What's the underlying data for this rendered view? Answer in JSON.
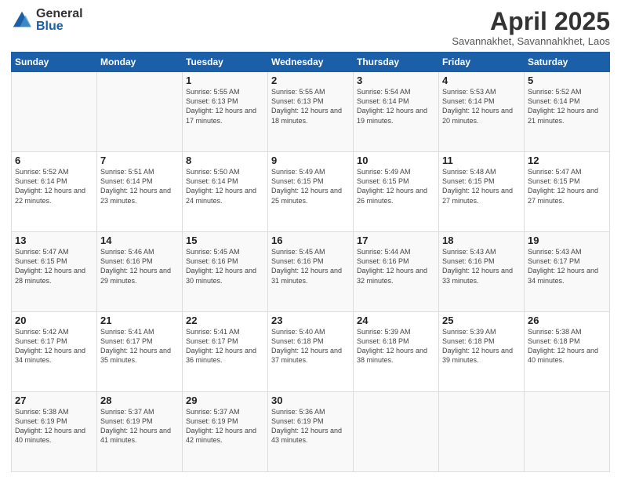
{
  "logo": {
    "general": "General",
    "blue": "Blue"
  },
  "header": {
    "month": "April 2025",
    "location": "Savannakhet, Savannahkhet, Laos"
  },
  "weekdays": [
    "Sunday",
    "Monday",
    "Tuesday",
    "Wednesday",
    "Thursday",
    "Friday",
    "Saturday"
  ],
  "weeks": [
    [
      {
        "day": "",
        "info": ""
      },
      {
        "day": "",
        "info": ""
      },
      {
        "day": "1",
        "info": "Sunrise: 5:55 AM\nSunset: 6:13 PM\nDaylight: 12 hours and 17 minutes."
      },
      {
        "day": "2",
        "info": "Sunrise: 5:55 AM\nSunset: 6:13 PM\nDaylight: 12 hours and 18 minutes."
      },
      {
        "day": "3",
        "info": "Sunrise: 5:54 AM\nSunset: 6:14 PM\nDaylight: 12 hours and 19 minutes."
      },
      {
        "day": "4",
        "info": "Sunrise: 5:53 AM\nSunset: 6:14 PM\nDaylight: 12 hours and 20 minutes."
      },
      {
        "day": "5",
        "info": "Sunrise: 5:52 AM\nSunset: 6:14 PM\nDaylight: 12 hours and 21 minutes."
      }
    ],
    [
      {
        "day": "6",
        "info": "Sunrise: 5:52 AM\nSunset: 6:14 PM\nDaylight: 12 hours and 22 minutes."
      },
      {
        "day": "7",
        "info": "Sunrise: 5:51 AM\nSunset: 6:14 PM\nDaylight: 12 hours and 23 minutes."
      },
      {
        "day": "8",
        "info": "Sunrise: 5:50 AM\nSunset: 6:14 PM\nDaylight: 12 hours and 24 minutes."
      },
      {
        "day": "9",
        "info": "Sunrise: 5:49 AM\nSunset: 6:15 PM\nDaylight: 12 hours and 25 minutes."
      },
      {
        "day": "10",
        "info": "Sunrise: 5:49 AM\nSunset: 6:15 PM\nDaylight: 12 hours and 26 minutes."
      },
      {
        "day": "11",
        "info": "Sunrise: 5:48 AM\nSunset: 6:15 PM\nDaylight: 12 hours and 27 minutes."
      },
      {
        "day": "12",
        "info": "Sunrise: 5:47 AM\nSunset: 6:15 PM\nDaylight: 12 hours and 27 minutes."
      }
    ],
    [
      {
        "day": "13",
        "info": "Sunrise: 5:47 AM\nSunset: 6:15 PM\nDaylight: 12 hours and 28 minutes."
      },
      {
        "day": "14",
        "info": "Sunrise: 5:46 AM\nSunset: 6:16 PM\nDaylight: 12 hours and 29 minutes."
      },
      {
        "day": "15",
        "info": "Sunrise: 5:45 AM\nSunset: 6:16 PM\nDaylight: 12 hours and 30 minutes."
      },
      {
        "day": "16",
        "info": "Sunrise: 5:45 AM\nSunset: 6:16 PM\nDaylight: 12 hours and 31 minutes."
      },
      {
        "day": "17",
        "info": "Sunrise: 5:44 AM\nSunset: 6:16 PM\nDaylight: 12 hours and 32 minutes."
      },
      {
        "day": "18",
        "info": "Sunrise: 5:43 AM\nSunset: 6:16 PM\nDaylight: 12 hours and 33 minutes."
      },
      {
        "day": "19",
        "info": "Sunrise: 5:43 AM\nSunset: 6:17 PM\nDaylight: 12 hours and 34 minutes."
      }
    ],
    [
      {
        "day": "20",
        "info": "Sunrise: 5:42 AM\nSunset: 6:17 PM\nDaylight: 12 hours and 34 minutes."
      },
      {
        "day": "21",
        "info": "Sunrise: 5:41 AM\nSunset: 6:17 PM\nDaylight: 12 hours and 35 minutes."
      },
      {
        "day": "22",
        "info": "Sunrise: 5:41 AM\nSunset: 6:17 PM\nDaylight: 12 hours and 36 minutes."
      },
      {
        "day": "23",
        "info": "Sunrise: 5:40 AM\nSunset: 6:18 PM\nDaylight: 12 hours and 37 minutes."
      },
      {
        "day": "24",
        "info": "Sunrise: 5:39 AM\nSunset: 6:18 PM\nDaylight: 12 hours and 38 minutes."
      },
      {
        "day": "25",
        "info": "Sunrise: 5:39 AM\nSunset: 6:18 PM\nDaylight: 12 hours and 39 minutes."
      },
      {
        "day": "26",
        "info": "Sunrise: 5:38 AM\nSunset: 6:18 PM\nDaylight: 12 hours and 40 minutes."
      }
    ],
    [
      {
        "day": "27",
        "info": "Sunrise: 5:38 AM\nSunset: 6:19 PM\nDaylight: 12 hours and 40 minutes."
      },
      {
        "day": "28",
        "info": "Sunrise: 5:37 AM\nSunset: 6:19 PM\nDaylight: 12 hours and 41 minutes."
      },
      {
        "day": "29",
        "info": "Sunrise: 5:37 AM\nSunset: 6:19 PM\nDaylight: 12 hours and 42 minutes."
      },
      {
        "day": "30",
        "info": "Sunrise: 5:36 AM\nSunset: 6:19 PM\nDaylight: 12 hours and 43 minutes."
      },
      {
        "day": "",
        "info": ""
      },
      {
        "day": "",
        "info": ""
      },
      {
        "day": "",
        "info": ""
      }
    ]
  ]
}
